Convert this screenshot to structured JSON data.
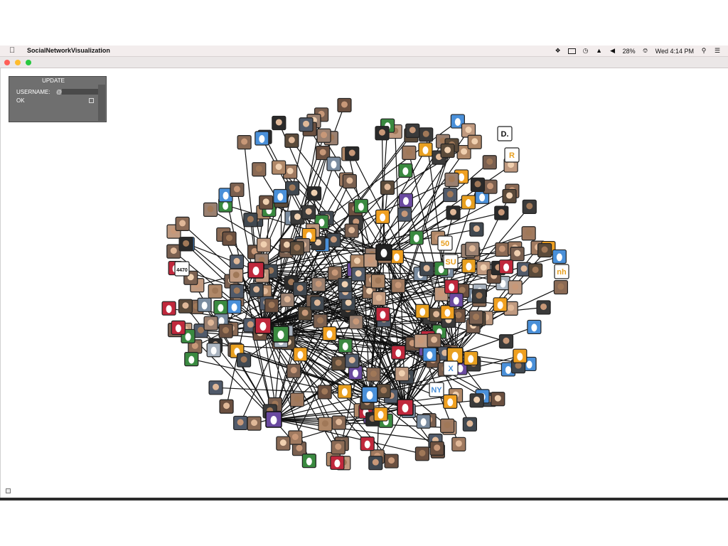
{
  "app": {
    "name": "SocialNetworkVisualization"
  },
  "menubar": {
    "battery": "28%",
    "clock": "Wed 4:14 PM",
    "icons": [
      "apple-icon",
      "dropbox-icon",
      "battery-icon",
      "time-machine-icon",
      "wifi-icon",
      "volume-icon",
      "input-source-icon",
      "spotlight-icon",
      "notification-center-icon"
    ]
  },
  "window": {
    "lights": [
      "#ff5f57",
      "#febc2e",
      "#28c840"
    ]
  },
  "panel": {
    "title": "UPDATE",
    "username_label": "USERNAME:",
    "username_value": "@",
    "ok_label": "OK"
  },
  "colors": {
    "edge": "#111111",
    "avatar_border": "#222222",
    "egg_palette": [
      "#e8a020",
      "#4a90d9",
      "#c0283c",
      "#7a8ca0",
      "#3a8a40",
      "#6a4aa0",
      "#f0a020",
      "#aab4c0"
    ]
  },
  "graph": {
    "hubs": [
      {
        "id": "hub-1",
        "color": "#c0283c"
      },
      {
        "id": "hub-2",
        "color": "#c0283c"
      },
      {
        "id": "hub-3",
        "color": "#3a8a40"
      },
      {
        "id": "hub-4",
        "color": "#222222"
      },
      {
        "id": "hub-5",
        "color": "#6a4aa0"
      },
      {
        "id": "hub-6",
        "color": "#4a90d9"
      },
      {
        "id": "hub-7",
        "color": "#c0283c"
      },
      {
        "id": "hub-8",
        "color": "#e8a020"
      }
    ],
    "labeled_avatars": [
      {
        "text": "D.",
        "color": "#111111"
      },
      {
        "text": "R",
        "color": "#e8a020"
      },
      {
        "text": "nh",
        "color": "#e8a020"
      },
      {
        "text": "50",
        "color": "#e8a020"
      },
      {
        "text": "SU",
        "color": "#e8a020"
      },
      {
        "text": "NY",
        "color": "#4a90d9"
      },
      {
        "text": "X",
        "color": "#4a90d9"
      },
      {
        "text": "4470",
        "color": "#111111"
      }
    ]
  }
}
